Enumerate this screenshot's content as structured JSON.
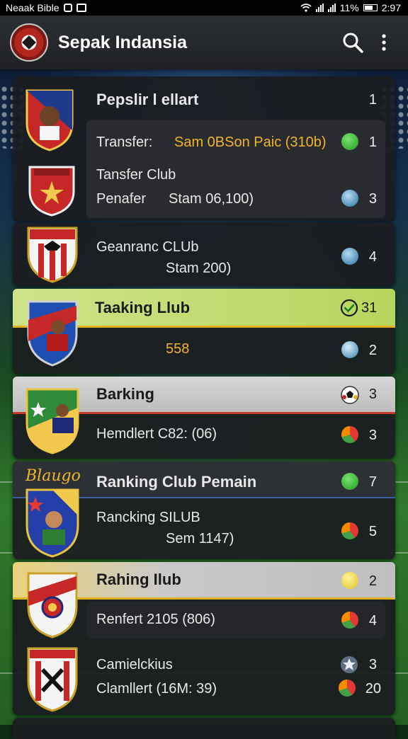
{
  "statusbar": {
    "left_text": "Neaak Bible",
    "right_text": "11% ",
    "time": "2:97"
  },
  "appbar": {
    "title": "Sepak Indansia",
    "icons": [
      "logo-icon",
      "search-icon",
      "more-vertical-icon"
    ]
  },
  "rows": {
    "r1": {
      "title": "Pepslir l ellart",
      "count": "1"
    },
    "r2": {
      "label": "Transfer:",
      "value": "Sam 0BSon Paic (310b)",
      "count": "1"
    },
    "r3": {
      "line1": "Tansfer  Club",
      "line2_label": "Penafer",
      "line2_value": "Stam 06,100)",
      "count": "3"
    },
    "r4": {
      "line1": "Geanranc CLUb",
      "line2": "Stam 200)",
      "count": "4"
    },
    "r5": {
      "title": "Taaking Llub",
      "count": "31",
      "value": "558",
      "count2": "2"
    },
    "r6": {
      "title": "Barking",
      "count": "3",
      "line2": "Hemdlert C82: (06)",
      "count2": "3"
    },
    "r7": {
      "title": "Ranking Club  Pemain",
      "count": "7",
      "script": "Blaugo",
      "line2": "Rancking SILUB",
      "line3": "Sem 1147)",
      "count2": "5"
    },
    "r8": {
      "title": "Rahing Ilub",
      "count": "2",
      "line2": "Renfert 2105 (806)",
      "count2": "4"
    },
    "r9": {
      "line1": "Camielckius",
      "count": "3",
      "line2": "Clamllert (16M: 39)",
      "count2": "20"
    }
  },
  "colors": {
    "accent_gold": "#f0b429",
    "highlight_green": "#c4dc73",
    "card_bg": "#1b1d20",
    "appbar_bg": "#2c2f33"
  }
}
